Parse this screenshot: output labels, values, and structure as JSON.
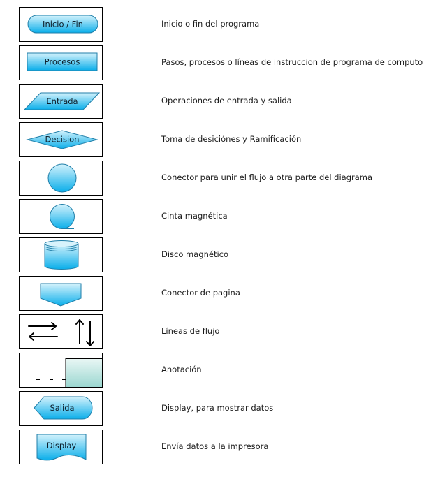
{
  "colors": {
    "shape_fill_top": "#c9eefb",
    "shape_fill_bottom": "#0fb0ec",
    "shape_stroke": "#1f7ea8",
    "annotation_fill_top": "#e6f5f3",
    "annotation_fill_bottom": "#9fd8d2",
    "border": "#000000"
  },
  "symbols": [
    {
      "shape": "terminator",
      "icon": "terminator-shape-icon",
      "label": "Inicio / Fin",
      "description": "Inicio o fin del programa"
    },
    {
      "shape": "process",
      "icon": "process-shape-icon",
      "label": "Procesos",
      "description": "Pasos, procesos o líneas de instruccion de programa de computo"
    },
    {
      "shape": "data",
      "icon": "parallelogram-shape-icon",
      "label": "Entrada",
      "description": "Operaciones de entrada y salida"
    },
    {
      "shape": "decision",
      "icon": "diamond-shape-icon",
      "label": "Decision",
      "description": "Toma de desiciónes y Ramificación"
    },
    {
      "shape": "connector",
      "icon": "circle-connector-icon",
      "label": "",
      "description": "Conector para unir el flujo a otra parte del diagrama"
    },
    {
      "shape": "magnetic-tape",
      "icon": "magnetic-tape-icon",
      "label": "",
      "description": "Cinta magnética"
    },
    {
      "shape": "magnetic-disk",
      "icon": "magnetic-disk-icon",
      "label": "",
      "description": "Disco magnético"
    },
    {
      "shape": "offpage-connector",
      "icon": "offpage-connector-icon",
      "label": "",
      "description": "Conector de pagina"
    },
    {
      "shape": "flow-lines",
      "icon": "flow-arrows-icon",
      "label": "",
      "description": "Líneas de flujo"
    },
    {
      "shape": "annotation",
      "icon": "annotation-icon",
      "label": "",
      "description": "Anotación"
    },
    {
      "shape": "display",
      "icon": "display-shape-icon",
      "label": "Salida",
      "description": "Display, para mostrar datos"
    },
    {
      "shape": "document",
      "icon": "document-shape-icon",
      "label": "Display",
      "description": "Envía datos a la impresora"
    }
  ]
}
